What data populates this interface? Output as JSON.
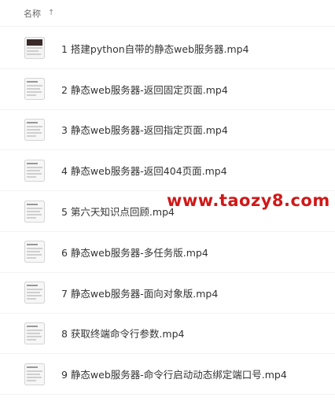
{
  "header": {
    "name_label": "名称",
    "sort_icon": "arrow-up-icon"
  },
  "files": [
    {
      "name": "1 搭建python自带的静态web服务器.mp4",
      "icon": "video-file-icon"
    },
    {
      "name": "2 静态web服务器-返回固定页面.mp4",
      "icon": "video-file-icon"
    },
    {
      "name": "3 静态web服务器-返回指定页面.mp4",
      "icon": "video-file-icon"
    },
    {
      "name": "4 静态web服务器-返回404页面.mp4",
      "icon": "video-file-icon"
    },
    {
      "name": "5 第六天知识点回顾.mp4",
      "icon": "video-file-icon"
    },
    {
      "name": "6 静态web服务器-多任务版.mp4",
      "icon": "video-file-icon"
    },
    {
      "name": "7 静态web服务器-面向对象版.mp4",
      "icon": "video-file-icon"
    },
    {
      "name": "8 获取终端命令行参数.mp4",
      "icon": "video-file-icon"
    },
    {
      "name": "9 静态web服务器-命令行启动动态绑定端口号.mp4",
      "icon": "video-file-icon"
    }
  ],
  "watermark": {
    "text": "www.taozy8.com",
    "color": "#d01818"
  }
}
